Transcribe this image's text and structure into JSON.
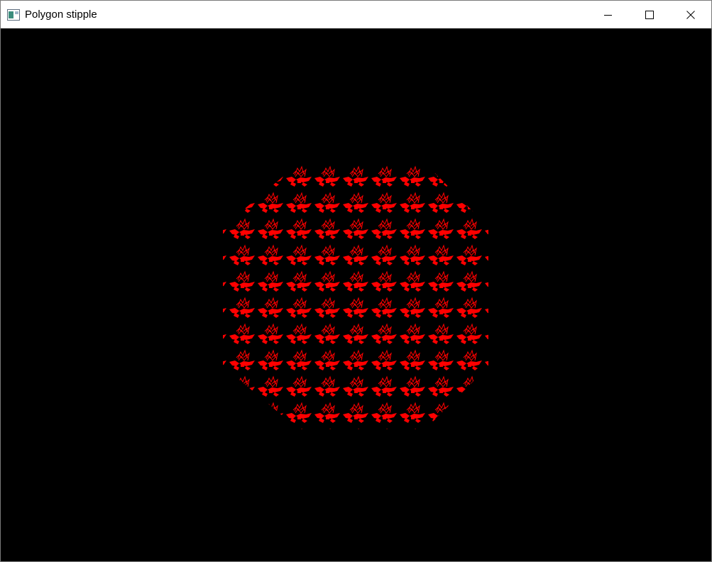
{
  "window": {
    "title": "Polygon stipple",
    "icon": "app-window-icon"
  },
  "controls": {
    "minimize_icon": "minimize-icon",
    "maximize_icon": "maximize-icon",
    "close_icon": "close-icon"
  },
  "canvas": {
    "background": "#000000",
    "fill_color": "#ff0000",
    "shape": "octagon",
    "pattern": "fly-stipple"
  }
}
